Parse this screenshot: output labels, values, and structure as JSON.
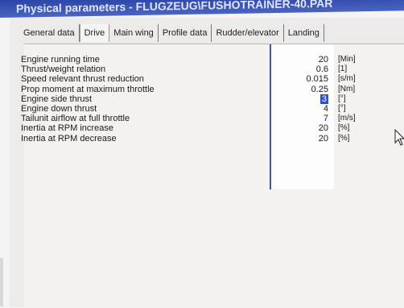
{
  "window": {
    "title": "Physical parameters - FLUGZEUG\\FUSHOTRAINER-40.PAR"
  },
  "tabs": [
    {
      "label": "General data",
      "active": false
    },
    {
      "label": "Drive",
      "active": true
    },
    {
      "label": "Main wing",
      "active": false
    },
    {
      "label": "Profile data",
      "active": false
    },
    {
      "label": "Rudder/elevator",
      "active": false
    },
    {
      "label": "Landing",
      "active": false
    }
  ],
  "params": [
    {
      "label": "Engine running time",
      "value": "20",
      "unit": "[Min]"
    },
    {
      "label": "Thrust/weight relation",
      "value": "0.6",
      "unit": "[1]"
    },
    {
      "label": "Speed relevant thrust reduction",
      "value": "0.015",
      "unit": "[s/m]"
    },
    {
      "label": "Prop moment at maximum throttle",
      "value": "0.25",
      "unit": "[Nm]"
    },
    {
      "label": "Engine side thrust",
      "value": "3",
      "unit": "[°]"
    },
    {
      "label": "Engine down thrust",
      "value": "4",
      "unit": "[°]"
    },
    {
      "label": "Tailunit airflow at full throttle",
      "value": "7",
      "unit": "[m/s]"
    },
    {
      "label": "Inertia at RPM increase",
      "value": "20",
      "unit": "[%]"
    },
    {
      "label": "Inertia at RPM decrease",
      "value": "20",
      "unit": "[%]"
    }
  ]
}
